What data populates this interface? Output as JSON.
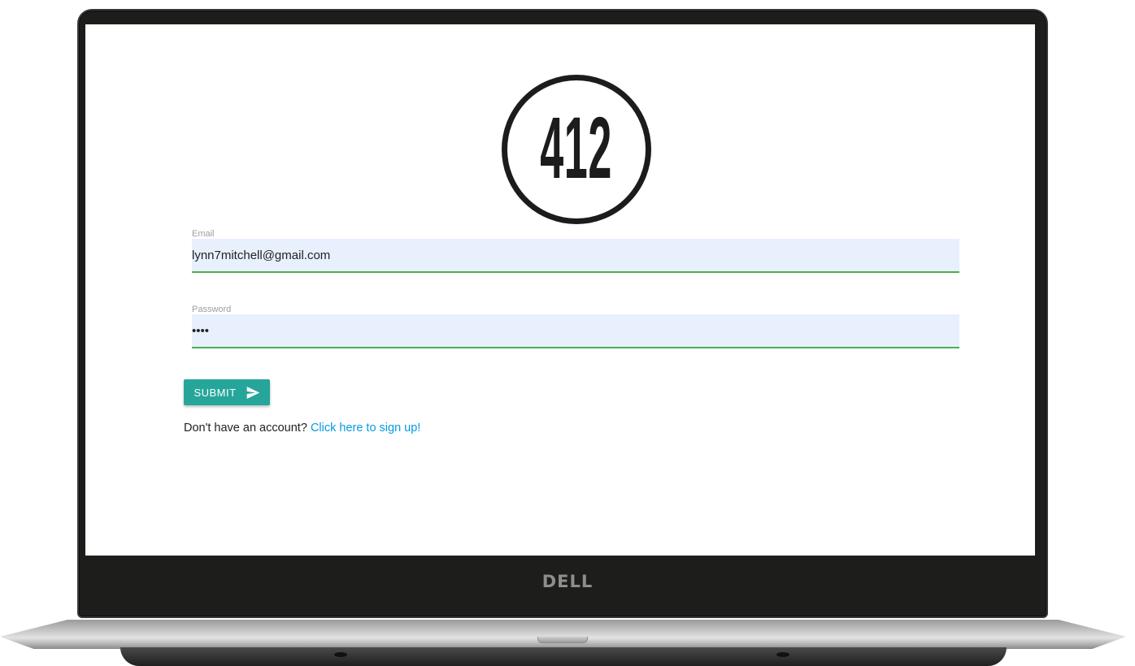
{
  "device": {
    "brand": "DELL"
  },
  "logo": {
    "text": "412"
  },
  "login_form": {
    "email": {
      "label": "Email",
      "value": "lynn7mitchell@gmail.com"
    },
    "password": {
      "label": "Password",
      "value": "••••"
    },
    "submit_label": "SUBMIT",
    "submit_icon": "send-icon",
    "signup_prompt": "Don't have an account? ",
    "signup_link": "Click here to sign up!"
  },
  "colors": {
    "submit_button": "#26a69a",
    "input_fill": "#e8f0fe",
    "input_valid_underline": "#4caf50",
    "link": "#039be5",
    "bezel": "#1d1d1b"
  }
}
